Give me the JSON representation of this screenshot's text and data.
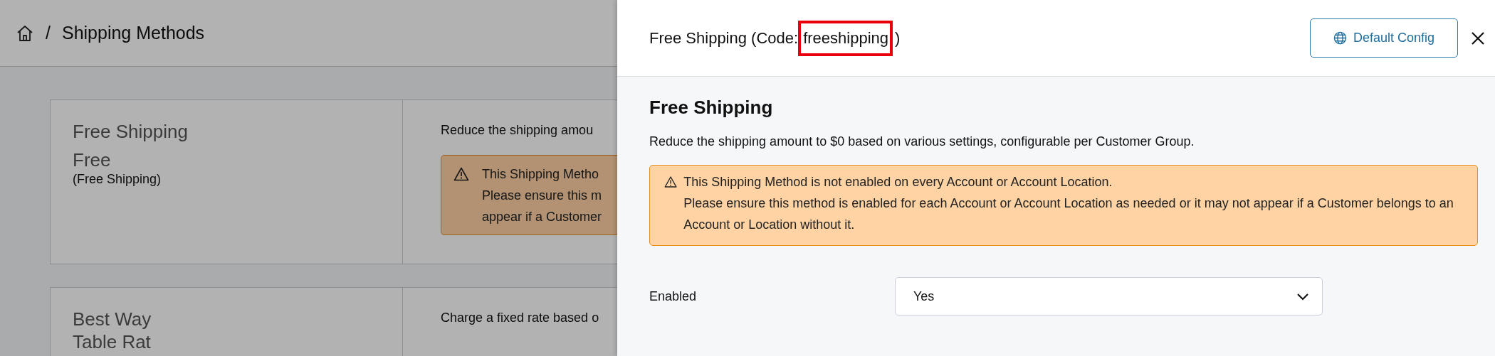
{
  "page": {
    "separator": "/",
    "breadcrumb": "Shipping Methods",
    "methods": [
      {
        "name": "Free Shipping",
        "code_name": "Free",
        "label": "(Free Shipping)",
        "description": "Reduce the shipping amou",
        "warning_lines": [
          "This Shipping Metho",
          "Please ensure this m",
          "appear if a Customer"
        ]
      },
      {
        "name": "Best Way",
        "code_name": "Table Rat",
        "description": "Charge a fixed rate based o"
      }
    ]
  },
  "panel": {
    "title": "Free Shipping (Code: ",
    "code": "freeshipping",
    "title_end": ")",
    "code_highlighted": true,
    "button": "Default Config",
    "heading": "Free Shipping",
    "description": "Reduce the shipping amount to $0 based on various settings, configurable per Customer Group.",
    "warning": [
      "This Shipping Method is not enabled on every Account or Account Location.",
      "Please ensure this method is enabled for each Account or Account Location as needed or it may not appear if a Customer belongs to an Account or Location without it."
    ],
    "fields": [
      {
        "label": "Enabled",
        "value": "Yes"
      }
    ]
  }
}
